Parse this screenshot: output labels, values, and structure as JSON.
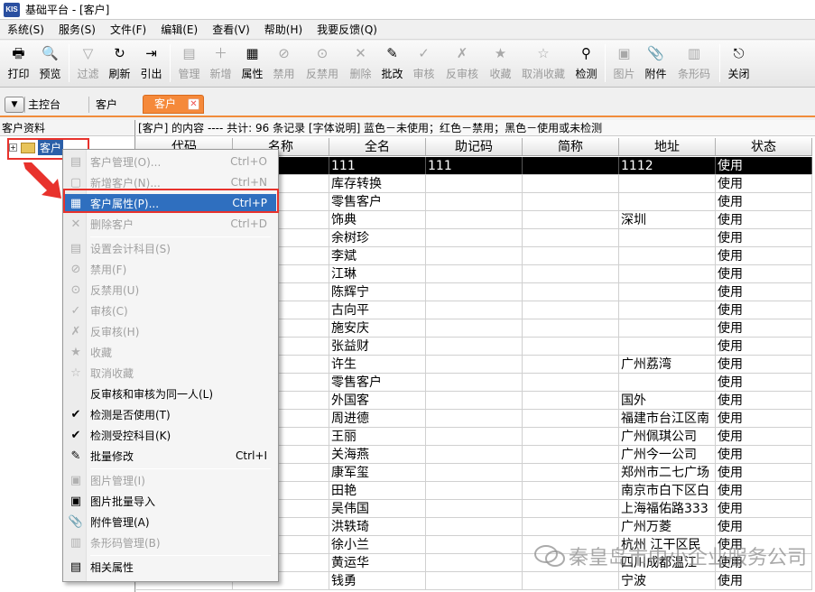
{
  "window": {
    "logo": "KIS",
    "title": "基础平台 - [客户]"
  },
  "menubar": [
    "系统(S)",
    "服务(S)",
    "文件(F)",
    "编辑(E)",
    "查看(V)",
    "帮助(H)",
    "我要反馈(Q)"
  ],
  "toolbar": [
    {
      "label": "打印",
      "icon": "printer-icon",
      "glyph": "🖶",
      "enabled": true
    },
    {
      "label": "预览",
      "icon": "preview-icon",
      "glyph": "🔍",
      "enabled": true
    },
    {
      "sep": true
    },
    {
      "label": "过滤",
      "icon": "filter-icon",
      "glyph": "▽",
      "enabled": false
    },
    {
      "label": "刷新",
      "icon": "refresh-icon",
      "glyph": "↻",
      "enabled": true
    },
    {
      "label": "引出",
      "icon": "export-icon",
      "glyph": "⇥",
      "enabled": true
    },
    {
      "sep": true
    },
    {
      "label": "管理",
      "icon": "manage-icon",
      "glyph": "▤",
      "enabled": false
    },
    {
      "label": "新增",
      "icon": "add-icon",
      "glyph": "＋",
      "enabled": false
    },
    {
      "label": "属性",
      "icon": "properties-icon",
      "glyph": "▦",
      "enabled": true
    },
    {
      "label": "禁用",
      "icon": "disable-icon",
      "glyph": "⊘",
      "enabled": false
    },
    {
      "label": "反禁用",
      "icon": "undisable-icon",
      "glyph": "⊙",
      "enabled": false,
      "wide": true
    },
    {
      "label": "删除",
      "icon": "delete-icon",
      "glyph": "✕",
      "enabled": false
    },
    {
      "label": "批改",
      "icon": "batch-edit-icon",
      "glyph": "✎",
      "enabled": true
    },
    {
      "label": "审核",
      "icon": "audit-icon",
      "glyph": "✓",
      "enabled": false
    },
    {
      "label": "反审核",
      "icon": "unaudit-icon",
      "glyph": "✗",
      "enabled": false,
      "wide": true
    },
    {
      "label": "收藏",
      "icon": "favorite-icon",
      "glyph": "★",
      "enabled": false
    },
    {
      "label": "取消收藏",
      "icon": "unfavorite-icon",
      "glyph": "☆",
      "enabled": false,
      "wide2": true
    },
    {
      "label": "检测",
      "icon": "detect-icon",
      "glyph": "⚲",
      "enabled": true
    },
    {
      "sep": true
    },
    {
      "label": "图片",
      "icon": "picture-icon",
      "glyph": "▣",
      "enabled": false
    },
    {
      "label": "附件",
      "icon": "attachment-icon",
      "glyph": "📎",
      "enabled": true
    },
    {
      "label": "条形码",
      "icon": "barcode-icon",
      "glyph": "▥",
      "enabled": false,
      "wide": true
    },
    {
      "sep": true
    },
    {
      "label": "关闭",
      "icon": "close-door-icon",
      "glyph": "⎋",
      "enabled": true
    }
  ],
  "tabs": {
    "home": "主控台",
    "customer": "客户",
    "active": "客户"
  },
  "tree": {
    "header": "客户资料",
    "root": "客户"
  },
  "grid": {
    "info": "[客户] 的内容 ---- 共计: 96 条记录  [字体说明] 蓝色－未使用；红色－禁用；黑色－使用或未检测",
    "columns": [
      "代码",
      "名称",
      "全名",
      "助记码",
      "简称",
      "地址",
      "状态"
    ],
    "rows": [
      [
        "",
        "",
        "111",
        "111",
        "",
        "1112",
        "使用"
      ],
      [
        "",
        "换",
        "库存转换",
        "",
        "",
        "",
        "使用"
      ],
      [
        "",
        "户",
        "零售客户",
        "",
        "",
        "",
        "使用"
      ],
      [
        "",
        "",
        "饰典",
        "",
        "",
        "深圳",
        "使用"
      ],
      [
        "",
        "",
        "余树珍",
        "",
        "",
        "",
        "使用"
      ],
      [
        "",
        "",
        "李斌",
        "",
        "",
        "",
        "使用"
      ],
      [
        "",
        "",
        "江琳",
        "",
        "",
        "",
        "使用"
      ],
      [
        "",
        "",
        "陈辉宁",
        "",
        "",
        "",
        "使用"
      ],
      [
        "",
        "",
        "古向平",
        "",
        "",
        "",
        "使用"
      ],
      [
        "",
        "",
        "施安庆",
        "",
        "",
        "",
        "使用"
      ],
      [
        "",
        "",
        "张益财",
        "",
        "",
        "",
        "使用"
      ],
      [
        "",
        "",
        "许生",
        "",
        "",
        "广州荔湾",
        "使用"
      ],
      [
        "",
        "户",
        "零售客户",
        "",
        "",
        "",
        "使用"
      ],
      [
        "",
        "",
        "外国客",
        "",
        "",
        "国外",
        "使用"
      ],
      [
        "",
        "",
        "周进德",
        "",
        "",
        "福建市台江区南",
        "使用"
      ],
      [
        "",
        "",
        "王丽",
        "",
        "",
        "广州佩琪公司",
        "使用"
      ],
      [
        "",
        "",
        "关海燕",
        "",
        "",
        "广州今一公司",
        "使用"
      ],
      [
        "",
        "",
        "康军玺",
        "",
        "",
        "郑州市二七广场",
        "使用"
      ],
      [
        "",
        "",
        "田艳",
        "",
        "",
        "南京市白下区白",
        "使用"
      ],
      [
        "",
        "",
        "吴伟国",
        "",
        "",
        "上海福佑路333",
        "使用"
      ],
      [
        "",
        "",
        "洪轶琦",
        "",
        "",
        "广州万菱",
        "使用"
      ],
      [
        "",
        "",
        "徐小兰",
        "",
        "",
        "杭州 江干区民",
        "使用"
      ],
      [
        "",
        "",
        "黄运华",
        "",
        "",
        "四川成都温江",
        "使用"
      ],
      [
        "",
        "",
        "钱勇",
        "",
        "",
        "宁波",
        "使用"
      ]
    ]
  },
  "context_menu": [
    {
      "label": "客户管理(O)...",
      "shortcut": "Ctrl+O",
      "icon": "manage-icon",
      "glyph": "▤",
      "enabled": false
    },
    {
      "label": "新增客户(N)...",
      "shortcut": "Ctrl+N",
      "icon": "new-customer-icon",
      "glyph": "▢",
      "enabled": false
    },
    {
      "label": "客户属性(P)...",
      "shortcut": "Ctrl+P",
      "icon": "properties-icon",
      "glyph": "▦",
      "enabled": true,
      "highlight": true
    },
    {
      "label": "删除客户",
      "shortcut": "Ctrl+D",
      "icon": "delete-icon",
      "glyph": "✕",
      "enabled": false
    },
    {
      "sep": true
    },
    {
      "label": "设置会计科目(S)",
      "shortcut": "",
      "icon": "account-icon",
      "glyph": "▤",
      "enabled": false
    },
    {
      "label": "禁用(F)",
      "shortcut": "",
      "icon": "disable-icon",
      "glyph": "⊘",
      "enabled": false
    },
    {
      "label": "反禁用(U)",
      "shortcut": "",
      "icon": "undisable-icon",
      "glyph": "⊙",
      "enabled": false
    },
    {
      "label": "审核(C)",
      "shortcut": "",
      "icon": "audit-icon",
      "glyph": "✓",
      "enabled": false
    },
    {
      "label": "反审核(H)",
      "shortcut": "",
      "icon": "unaudit-icon",
      "glyph": "✗",
      "enabled": false
    },
    {
      "label": "收藏",
      "shortcut": "",
      "icon": "favorite-icon",
      "glyph": "★",
      "enabled": false
    },
    {
      "label": "取消收藏",
      "shortcut": "",
      "icon": "unfavorite-icon",
      "glyph": "☆",
      "enabled": false
    },
    {
      "label": "反审核和审核为同一人(L)",
      "shortcut": "",
      "icon": "",
      "glyph": "",
      "enabled": true
    },
    {
      "label": "检测是否使用(T)",
      "shortcut": "",
      "icon": "check-usage-icon",
      "glyph": "✔",
      "enabled": true
    },
    {
      "label": "检测受控科目(K)",
      "shortcut": "",
      "icon": "check-subject-icon",
      "glyph": "✔",
      "enabled": true
    },
    {
      "label": "批量修改",
      "shortcut": "Ctrl+I",
      "icon": "batch-edit-icon",
      "glyph": "✎",
      "enabled": true
    },
    {
      "sep": true
    },
    {
      "label": "图片管理(I)",
      "shortcut": "",
      "icon": "picture-icon",
      "glyph": "▣",
      "enabled": false
    },
    {
      "label": "图片批量导入",
      "shortcut": "",
      "icon": "picture-import-icon",
      "glyph": "▣",
      "enabled": true
    },
    {
      "label": "附件管理(A)",
      "shortcut": "",
      "icon": "attachment-icon",
      "glyph": "📎",
      "enabled": true
    },
    {
      "label": "条形码管理(B)",
      "shortcut": "",
      "icon": "barcode-icon",
      "glyph": "▥",
      "enabled": false
    },
    {
      "sep": true
    },
    {
      "label": "相关属性",
      "shortcut": "",
      "icon": "related-props-icon",
      "glyph": "▤",
      "enabled": true
    }
  ],
  "watermark": "秦皇岛市中小企业服务公司",
  "colors": {
    "accent_tab": "#f5893a",
    "highlight": "#2f6fbf",
    "annotation_red": "#e8322c",
    "selected_row": "#000000"
  }
}
